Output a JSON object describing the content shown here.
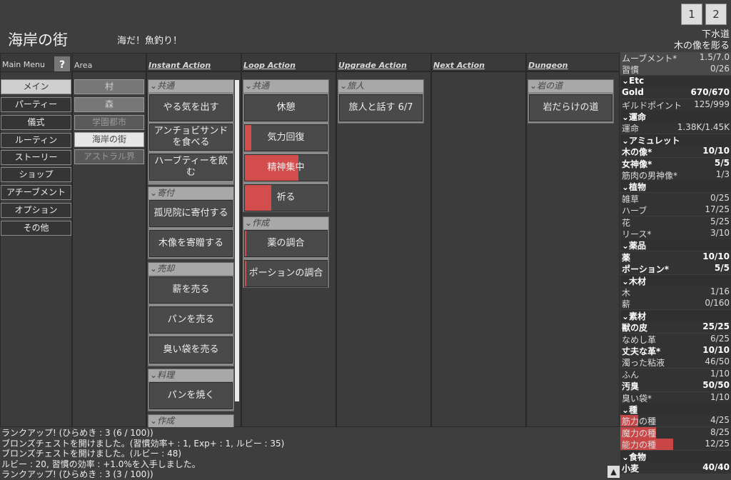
{
  "top": {
    "btn1": "1",
    "btn2": "2",
    "location": "海岸の街",
    "subtitle": "海だ！魚釣り！",
    "right1": "下水道",
    "right2": "木の像を彫る"
  },
  "headers": {
    "menu": "Main Menu",
    "help": "?",
    "area": "Area",
    "instant": "Instant Action",
    "loop": "Loop Action",
    "upgrade": "Upgrade Action",
    "next": "Next Action",
    "dungeon": "Dungeon"
  },
  "menu": [
    "メイン",
    "パーティー",
    "儀式",
    "ルーティン",
    "ストーリー",
    "ショップ",
    "アチーブメント",
    "オプション",
    "その他"
  ],
  "areas": [
    "村",
    "森",
    "学園都市",
    "海岸の街",
    "アストラル界"
  ],
  "instant": {
    "g1": "共通",
    "b1": "やる気を出す",
    "b2": "アンチョビサンドを食べる",
    "b3": "ハーブティーを飲む",
    "g2": "寄付",
    "b4": "孤児院に寄付する",
    "b5": "木像を寄贈する",
    "g3": "売却",
    "b6": "薪を売る",
    "b7": "パンを売る",
    "b8": "臭い袋を売る",
    "g4": "料理",
    "b9": "パンを焼く",
    "g5": "作成"
  },
  "loop": {
    "g1": "共通",
    "b1": "休憩",
    "b2": "気力回復",
    "b3": "精神集中",
    "b4": "祈る",
    "g2": "作成",
    "b5": "薬の調合",
    "b6": "ポーションの調合",
    "fills": {
      "b1": 0,
      "b2": 0.08,
      "b3": 0.65,
      "b4": 0.32,
      "b5": 0.02,
      "b6": 0.02
    }
  },
  "upgrade": {
    "g1": "旅人",
    "b1": "旅人と話す 6/7"
  },
  "dungeon": {
    "g1": "岩の道",
    "b1": "岩だらけの道"
  },
  "side": [
    {
      "n": "ムーブメント*",
      "v": "1.5/7.0",
      "t": "bg"
    },
    {
      "n": "習慣",
      "v": "0/26",
      "t": "bg"
    },
    {
      "n": "⌄Etc",
      "v": "",
      "t": "sec"
    },
    {
      "n": "Gold",
      "v": "670/670",
      "t": "b"
    },
    {
      "n": "ギルドポイント",
      "v": "125/999",
      "t": ""
    },
    {
      "n": "⌄運命",
      "v": "",
      "t": "sec"
    },
    {
      "n": "運命",
      "v": "1.38K/1.45K",
      "t": ""
    },
    {
      "n": "⌄アミュレット",
      "v": "",
      "t": "sec"
    },
    {
      "n": "木の像*",
      "v": "10/10",
      "t": "b"
    },
    {
      "n": "女神像*",
      "v": "5/5",
      "t": "b"
    },
    {
      "n": "筋肉の男神像*",
      "v": "1/3",
      "t": ""
    },
    {
      "n": "⌄植物",
      "v": "",
      "t": "sec"
    },
    {
      "n": "雑草",
      "v": "0/25",
      "t": ""
    },
    {
      "n": "ハーブ",
      "v": "17/25",
      "t": ""
    },
    {
      "n": "花",
      "v": "5/25",
      "t": ""
    },
    {
      "n": "リース*",
      "v": "3/10",
      "t": ""
    },
    {
      "n": "⌄薬品",
      "v": "",
      "t": "sec"
    },
    {
      "n": "薬",
      "v": "10/10",
      "t": "b"
    },
    {
      "n": "ポーション*",
      "v": "5/5",
      "t": "b"
    },
    {
      "n": "⌄木材",
      "v": "",
      "t": "sec"
    },
    {
      "n": "木",
      "v": "1/16",
      "t": ""
    },
    {
      "n": "薪",
      "v": "0/160",
      "t": ""
    },
    {
      "n": "⌄素材",
      "v": "",
      "t": "sec"
    },
    {
      "n": "獣の皮",
      "v": "25/25",
      "t": "b"
    },
    {
      "n": "なめし革",
      "v": "6/25",
      "t": ""
    },
    {
      "n": "丈夫な革*",
      "v": "10/10",
      "t": "b"
    },
    {
      "n": "濁った粘液",
      "v": "46/50",
      "t": ""
    },
    {
      "n": "ふん",
      "v": "1/10",
      "t": ""
    },
    {
      "n": "汚臭",
      "v": "50/50",
      "t": "b"
    },
    {
      "n": "臭い袋*",
      "v": "1/10",
      "t": ""
    },
    {
      "n": "⌄種",
      "v": "",
      "t": "sec"
    },
    {
      "n": "筋力の種",
      "v": "4/25",
      "t": "bar",
      "f": 0.16
    },
    {
      "n": "魔力の種",
      "v": "8/25",
      "t": "bar",
      "f": 0.32
    },
    {
      "n": "能力の種",
      "v": "12/25",
      "t": "bar",
      "f": 0.48
    },
    {
      "n": "⌄食物",
      "v": "",
      "t": "sec"
    },
    {
      "n": "小麦",
      "v": "40/40",
      "t": "b"
    }
  ],
  "log": [
    "ランクアップ! (ひらめき : 3 (6 / 100))",
    "ブロンズチェストを開けました。(習慣効率+ : 1, Exp+ : 1, ルビー : 35)",
    "ブロンズチェストを開けました。(ルビー : 48)",
    "ルビー : 20, 習慣の効率 : +1.0%を入手しました。",
    "ランクアップ! (ひらめき : 3 (3 / 100))"
  ],
  "up": "▲"
}
